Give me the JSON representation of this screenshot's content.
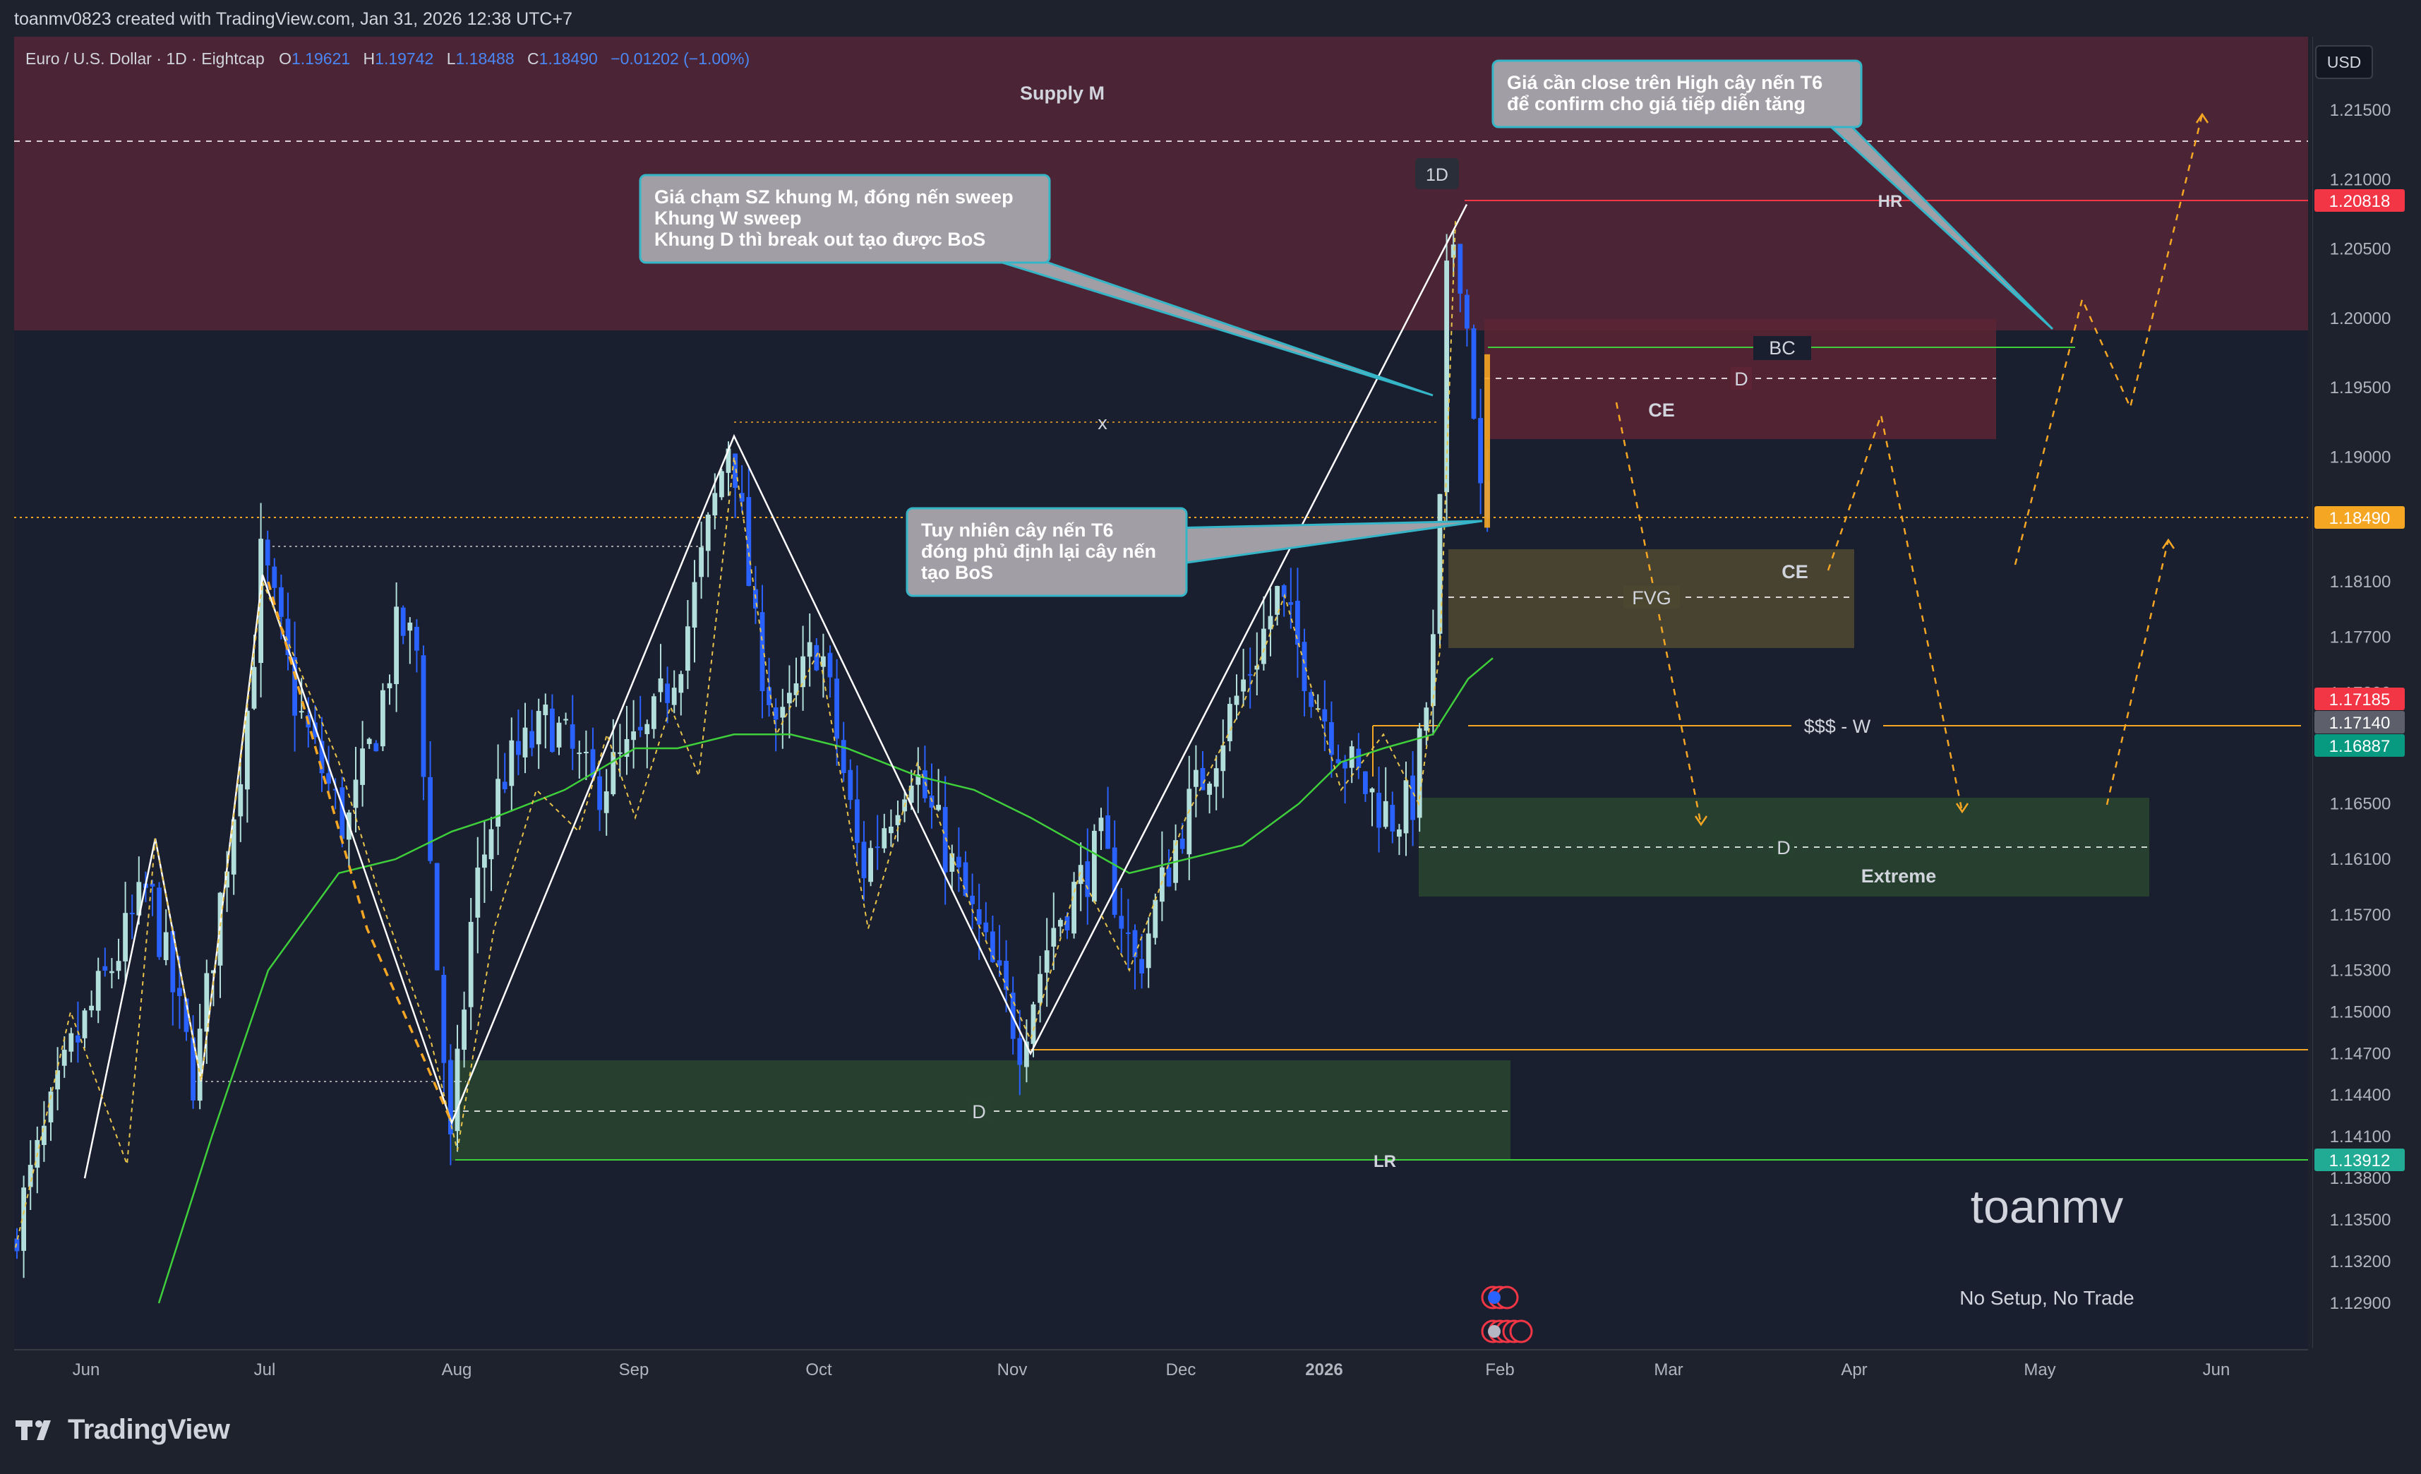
{
  "header": {
    "attribution": "toanmv0823 created with TradingView.com, Jan 31, 2026 12:38 UTC+7"
  },
  "symbol": {
    "name": "Euro / U.S. Dollar · 1D · Eightcap",
    "o_label": "O",
    "o": "1.19621",
    "h_label": "H",
    "h": "1.19742",
    "l_label": "L",
    "l": "1.18488",
    "c_label": "C",
    "c": "1.18490",
    "change": "−0.01202 (−1.00%)"
  },
  "currency": "USD",
  "colors": {
    "background": "#1a1f30",
    "supply_zone": "#5a2a3a",
    "bull": "#b2dfdb",
    "bear": "#2962ff",
    "ema": "#3ecf3a",
    "orange": "#f5a623",
    "red": "#f23645",
    "green": "#089981"
  },
  "labels": {
    "supply_m": "Supply M",
    "timeframe": "1D",
    "hr": "HR",
    "bc": "BC",
    "d_upper": "D",
    "ce_upper": "CE",
    "x_mark": "x",
    "ce_fvg": "CE",
    "fvg": "FVG",
    "liquidity_w": "$$$ - W",
    "d_extreme": "D",
    "extreme": "Extreme",
    "d_lower": "D",
    "lr": "LR",
    "watermark": "toanmv",
    "motto": "No Setup, No Trade"
  },
  "callouts": [
    {
      "text": "Giá chạm SZ khung M, đóng nến sweep\nKhung W sweep\nKhung D thì break out tạo được BoS"
    },
    {
      "text": "Tuy nhiên cây nến T6\nđóng phủ định lại cây nến\ntạo BoS"
    },
    {
      "text": "Giá cần close trên High cây nến T6\nđể confirm cho giá tiếp diễn tăng"
    }
  ],
  "price_axis": {
    "ticks": [
      "1.21500",
      "1.21000",
      "1.20500",
      "1.20000",
      "1.19500",
      "1.19000",
      "1.18100",
      "1.17700",
      "1.17300",
      "1.16500",
      "1.16100",
      "1.15700",
      "1.15300",
      "1.15000",
      "1.14700",
      "1.14400",
      "1.14100",
      "1.13800",
      "1.13500",
      "1.13200",
      "1.12900"
    ],
    "badges": [
      {
        "text": "1.20818",
        "color": "#f23645"
      },
      {
        "text": "1.18490",
        "color": "#f5a623"
      },
      {
        "text": "1.17185",
        "color": "#f23645"
      },
      {
        "text": "1.17140",
        "color": "#5d606b"
      },
      {
        "text": "1.16887",
        "color": "#089981"
      },
      {
        "text": "1.13912",
        "color": "#22ab94"
      }
    ]
  },
  "time_axis": {
    "labels": [
      "Jun",
      "Jul",
      "Aug",
      "Sep",
      "Oct",
      "Nov",
      "Dec",
      "2026",
      "Feb",
      "Mar",
      "Apr",
      "May",
      "Jun"
    ]
  },
  "footer": {
    "brand": "TradingView"
  },
  "chart_data": {
    "type": "candlestick",
    "symbol": "EURUSD",
    "timeframe": "1D",
    "x": [
      "Jun",
      "Jul",
      "Aug",
      "Sep",
      "Oct",
      "Nov",
      "Dec",
      "2026",
      "Feb",
      "Mar",
      "Apr",
      "May",
      "Jun"
    ],
    "ylim": [
      1.1265,
      1.219
    ],
    "last_close": 1.1849,
    "levels": [
      {
        "name": "HR",
        "price": 1.20818
      },
      {
        "name": "BC",
        "price": 1.1974
      },
      {
        "name": "$$$ - W",
        "price": 1.1714
      },
      {
        "name": "LR",
        "price": 1.13912
      }
    ],
    "zones": [
      {
        "name": "Supply M",
        "top": 1.219,
        "bottom": 1.1988
      },
      {
        "name": "CE",
        "top": 1.1995,
        "bottom": 1.1907
      },
      {
        "name": "FVG",
        "top": 1.183,
        "bottom": 1.1757
      },
      {
        "name": "Extreme",
        "top": 1.1648,
        "bottom": 1.1577
      },
      {
        "name": "D",
        "top": 1.1459,
        "bottom": 1.1388
      }
    ]
  }
}
